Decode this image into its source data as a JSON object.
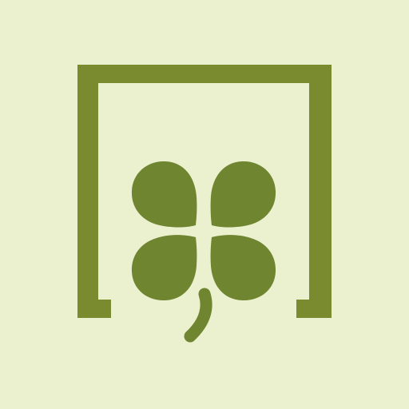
{
  "colors": {
    "background": "#EBF0CE",
    "accent": "#7A8A2E",
    "leaf": "#6F8530"
  },
  "icons": {
    "frame": "bracket-frame-icon",
    "clover": "four-leaf-clover-icon"
  }
}
